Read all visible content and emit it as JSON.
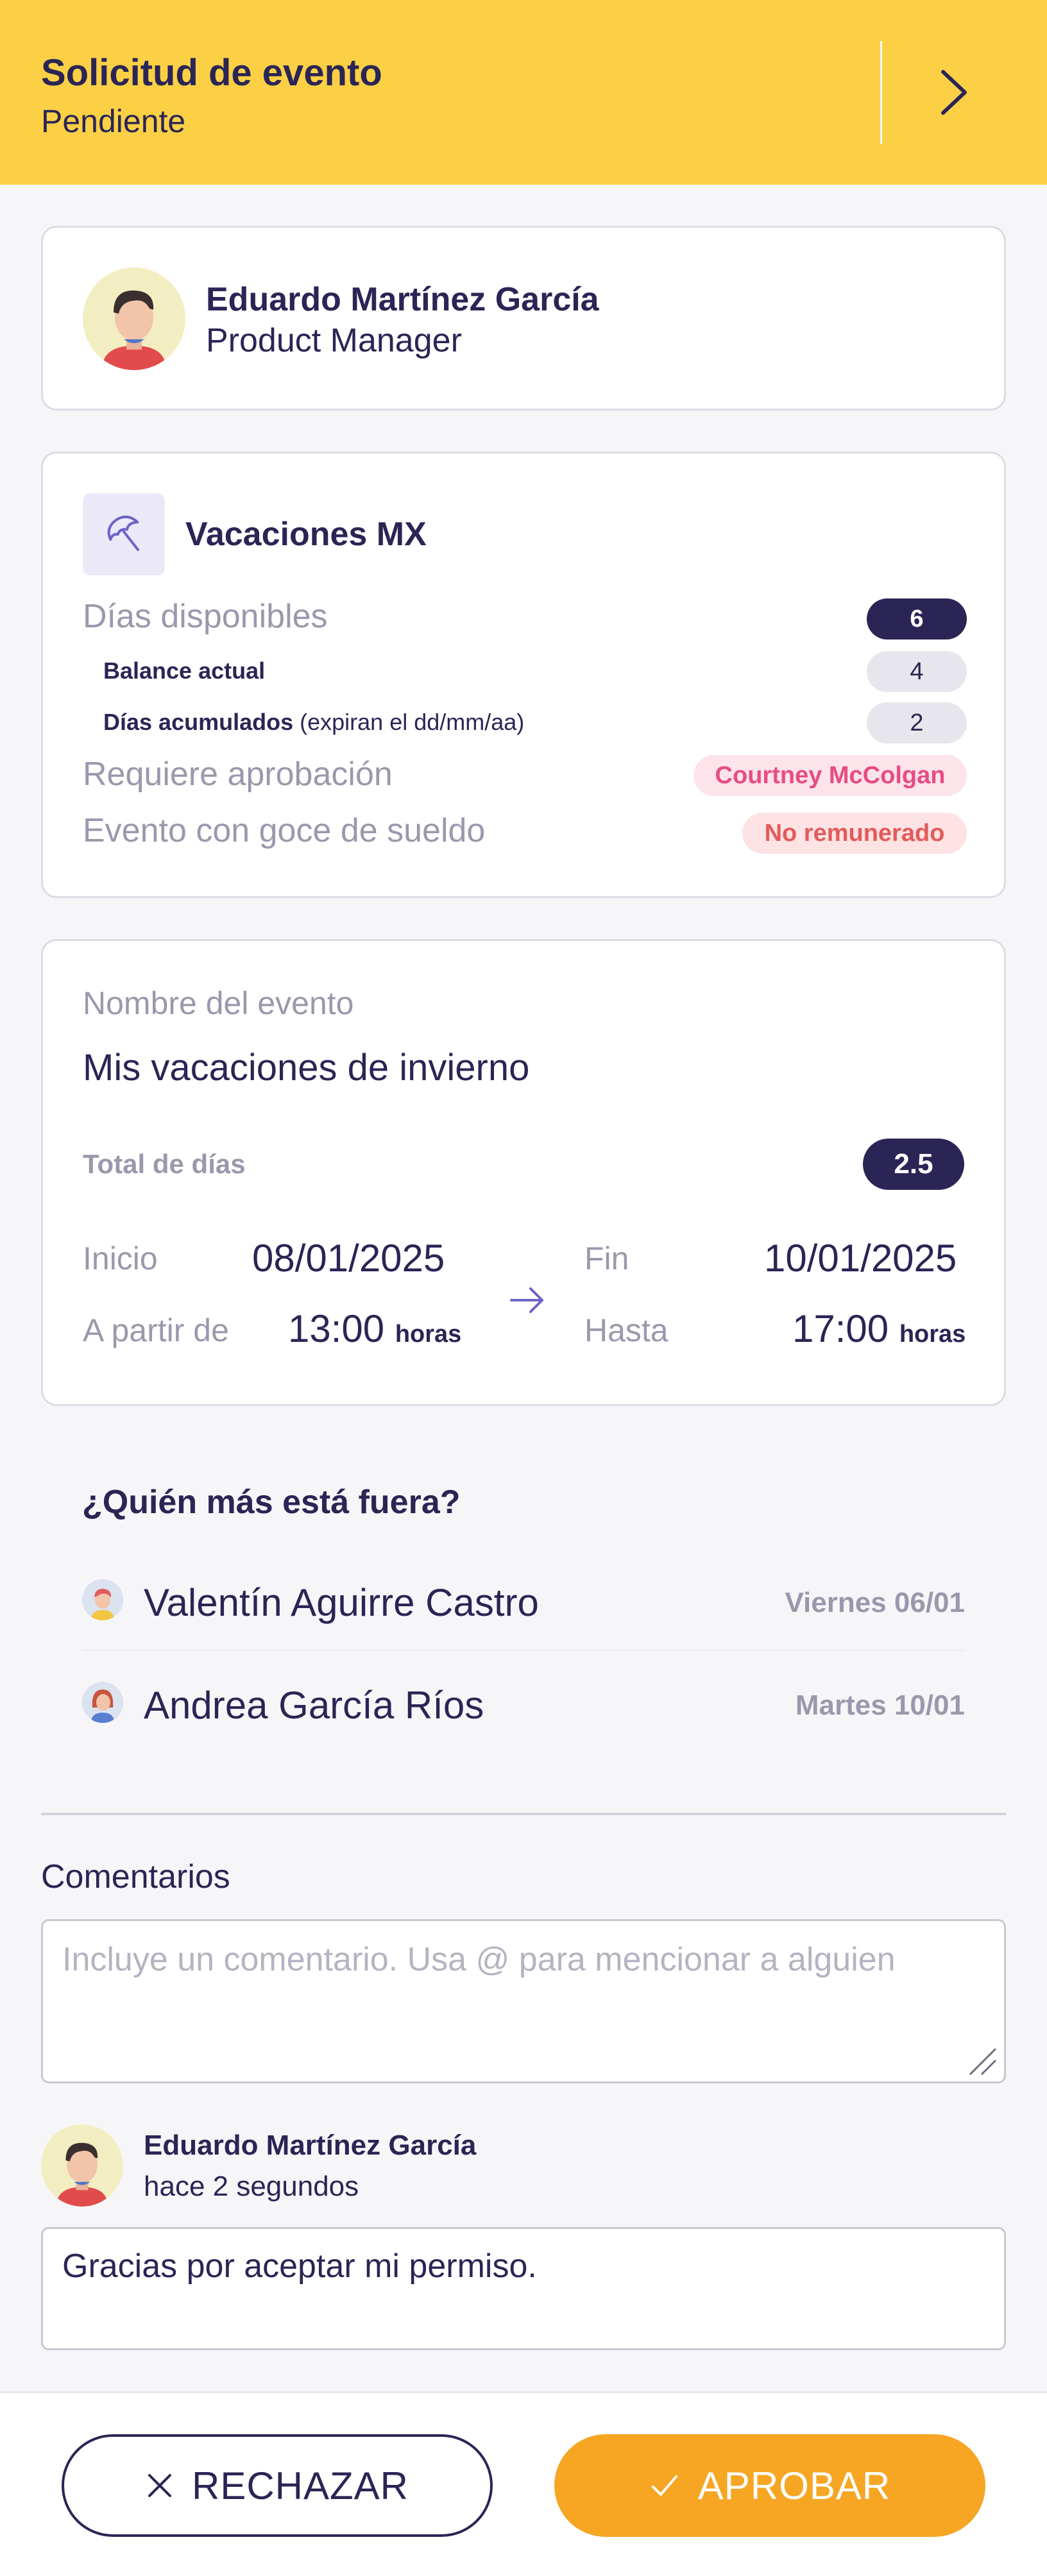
{
  "header": {
    "title": "Solicitud de evento",
    "status": "Pendiente",
    "next_icon": "chevron-right-icon",
    "background": "#fbd045"
  },
  "employee": {
    "name": "Eduardo Martínez García",
    "role": "Product Manager"
  },
  "balance": {
    "type_icon": "umbrella-icon",
    "type_name": "Vacaciones MX",
    "available_label": "Días disponibles",
    "available_value": "6",
    "current_label": "Balance actual",
    "current_value": "4",
    "accrued_label": "Días acumulados",
    "accrued_note": "(expiran el dd/mm/aa)",
    "accrued_value": "2",
    "approval_label": "Requiere aprobación",
    "approver": "Courtney McColgan",
    "paid_label": "Evento con goce de sueldo",
    "paid_value": "No remunerado"
  },
  "event": {
    "name_label": "Nombre del evento",
    "name": "Mis vacaciones de invierno",
    "total_label": "Total de días",
    "total_value": "2.5",
    "start_label": "Inicio",
    "start_date": "08/01/2025",
    "from_label": "A partir de",
    "start_time": "13:00",
    "end_label": "Fin",
    "end_date": "10/01/2025",
    "until_label": "Hasta",
    "end_time": "17:00",
    "hours_unit": "horas"
  },
  "who_else_out": {
    "title": "¿Quién más está fuera?",
    "people": [
      {
        "name": "Valentín Aguirre Castro",
        "date": "Viernes 06/01"
      },
      {
        "name": "Andrea García Ríos",
        "date": "Martes 10/01"
      }
    ]
  },
  "comments": {
    "label": "Comentarios",
    "placeholder": "Incluye un comentario. Usa @ para mencionar a alguien",
    "items": [
      {
        "author": "Eduardo Martínez García",
        "time": "hace 2 segundos",
        "text": "Gracias por aceptar mi permiso."
      }
    ]
  },
  "actions": {
    "reject_label": "RECHAZAR",
    "approve_label": "APROBAR",
    "reject_icon": "close-icon",
    "approve_icon": "check-icon",
    "approve_color": "#f6a623"
  },
  "colors": {
    "primary": "#2b2555",
    "muted": "#9a98ac",
    "accent": "#fbd045"
  }
}
